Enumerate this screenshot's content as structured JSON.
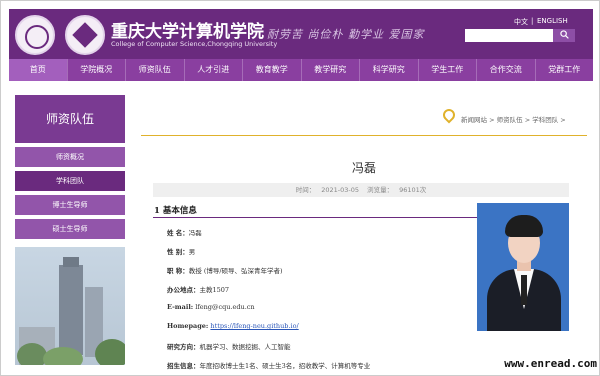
{
  "header": {
    "college_title": "重庆大学计算机学院",
    "college_subtitle": "College of Computer Science,Chongqing University",
    "motto": "耐劳苦  尚俭朴  勤学业  爱国家",
    "lang_zh": "中文",
    "lang_sep": "|",
    "lang_en": "ENGLISH",
    "search_placeholder": "",
    "search_icon": "search-icon"
  },
  "nav": {
    "items": [
      "首页",
      "学院概况",
      "师资队伍",
      "人才引进",
      "教育教学",
      "教学研究",
      "科学研究",
      "学生工作",
      "合作交流",
      "党群工作"
    ],
    "active_index": 0
  },
  "sidebar": {
    "title": "师资队伍",
    "items": [
      "师资概况",
      "学科团队",
      "博士生导师",
      "硕士生导师"
    ],
    "active_index": 1
  },
  "breadcrumb": {
    "items": [
      "新闻网站",
      "师资队伍",
      "学科团队"
    ],
    "separator": ">"
  },
  "article": {
    "title": "冯磊",
    "time_label": "时间：",
    "time": "2021-03-05",
    "views_label": "浏览量：",
    "views": "96101次",
    "section_title": "1 基本信息",
    "fields": {
      "name_label": "姓  名：",
      "name": "冯磊",
      "gender_label": "性  别：",
      "gender": "男",
      "title_label": "职  称：",
      "title": "教授 (博导/硕导、弘深青年学者)",
      "office_label": "办公地点：",
      "office": "主教1507",
      "email_label": "E-mail:",
      "email": "lfeng@cqu.edu.cn",
      "homepage_label": "Homepage:",
      "homepage": "https://lfeng-neu.github.io/",
      "research_label": "研究方向：",
      "research": "机器学习、数据挖掘、人工智能",
      "recruit_label": "招生信息：",
      "recruit": "年度招收博士生1名、硕士生3名，招收教学、计算机等专业"
    }
  },
  "watermark": "www.enread.com",
  "colors": {
    "brand_purple": "#6a2a7e",
    "nav_purple": "#8a3fa0",
    "accent_gold": "#e0b22c",
    "link_blue": "#2a56b8"
  }
}
